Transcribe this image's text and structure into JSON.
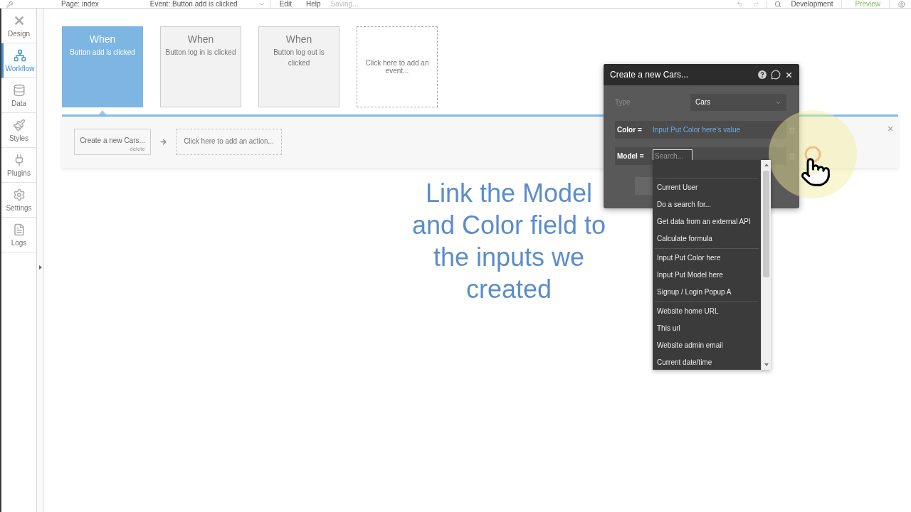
{
  "top_bar": {
    "page": "Page: index",
    "event": "Event: Button add is clicked",
    "menu": [
      "Edit",
      "Help"
    ],
    "status": "Saving...",
    "environment": "Development",
    "preview": "Preview"
  },
  "sidebar": {
    "items": [
      {
        "label": "Design",
        "selected": false
      },
      {
        "label": "Workflow",
        "selected": true
      },
      {
        "label": "Data",
        "selected": false
      },
      {
        "label": "Styles",
        "selected": false
      },
      {
        "label": "Plugins",
        "selected": false
      },
      {
        "label": "Settings",
        "selected": false
      },
      {
        "label": "Logs",
        "selected": false
      }
    ]
  },
  "events": [
    {
      "kind": "event",
      "title": "When",
      "description": "Button add is clicked",
      "selected": true
    },
    {
      "kind": "event",
      "title": "When",
      "description": "Button log in is clicked",
      "selected": false
    },
    {
      "kind": "event",
      "title": "When",
      "description": "Button log out is clicked",
      "selected": false
    },
    {
      "kind": "add",
      "label": "Click here to add an event..."
    }
  ],
  "actions": [
    {
      "kind": "action",
      "label": "Create a new Cars...",
      "delete": "delete"
    },
    {
      "kind": "add",
      "label": "Click here to add an action..."
    }
  ],
  "caption": "Link the Model and Color field to the inputs we created",
  "popup": {
    "title": "Create a new Cars...",
    "type_label": "Type",
    "type_value": "Cars",
    "fields": [
      {
        "label": "Color =",
        "value": "Input Put Color here's value"
      },
      {
        "label": "Model =",
        "placeholder": "Search..."
      }
    ]
  },
  "dropdown": {
    "groups": [
      [
        "Current User",
        "Do a search for...",
        "Get data from an external API",
        "Calculate formula"
      ],
      [
        "Input Put Color here",
        "Input Put Model here",
        "Signup / Login Popup A"
      ],
      [
        "Website home URL",
        "This url",
        "Website admin email",
        "Current date/time"
      ]
    ]
  }
}
